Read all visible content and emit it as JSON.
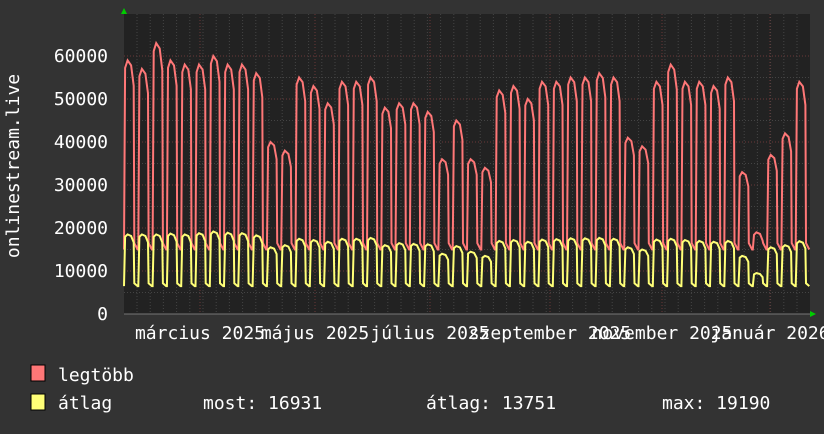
{
  "chart_data": {
    "type": "line",
    "ylabel": "onlinestream.live",
    "ylim": [
      0,
      65000
    ],
    "yticks": [
      0,
      10000,
      20000,
      30000,
      40000,
      50000,
      60000
    ],
    "xtick_labels": [
      "március 2025",
      "május 2025",
      "július 2025",
      "szeptember 2025",
      "november 2025",
      "január 2026"
    ],
    "grid": true,
    "colors": {
      "background": "#333333",
      "plot": "#222222",
      "legtobb": "#ff7777",
      "atlag": "#ffff77",
      "arrow": "#00cc00"
    },
    "series": [
      {
        "name": "legtöbb",
        "weekly_peak": [
          59000,
          57000,
          63000,
          59000,
          58000,
          58000,
          60000,
          58000,
          58000,
          56000,
          40000,
          38000,
          55000,
          53000,
          49000,
          54000,
          54000,
          55000,
          48000,
          49000,
          49000,
          47000,
          36000,
          45000,
          36000,
          34000,
          52000,
          53000,
          50000,
          54000,
          54000,
          55000,
          55000,
          56000,
          55000,
          41000,
          39000,
          54000,
          58000,
          54000,
          54000,
          53000,
          55000,
          33000,
          19000,
          37000,
          42000,
          54000
        ],
        "weekend_low": 15000
      },
      {
        "name": "átlag",
        "weekly_peak": [
          18500,
          18500,
          18500,
          18700,
          18500,
          18800,
          19190,
          18900,
          18800,
          18300,
          15500,
          16000,
          17500,
          17200,
          16800,
          17500,
          17500,
          17700,
          16000,
          16500,
          16300,
          16200,
          14000,
          15800,
          14500,
          13500,
          17000,
          17200,
          16800,
          17300,
          17400,
          17600,
          17600,
          17700,
          17500,
          15500,
          15000,
          17300,
          17500,
          17200,
          17000,
          16800,
          17000,
          13500,
          9500,
          15500,
          16000,
          16931
        ],
        "weekend_low": 6500
      }
    ]
  },
  "legend": {
    "items": [
      {
        "label": "legtöbb"
      },
      {
        "label": "átlag"
      }
    ],
    "stats": {
      "now": "most: 16931",
      "avg": "átlag: 13751",
      "max": "max: 19190"
    }
  }
}
